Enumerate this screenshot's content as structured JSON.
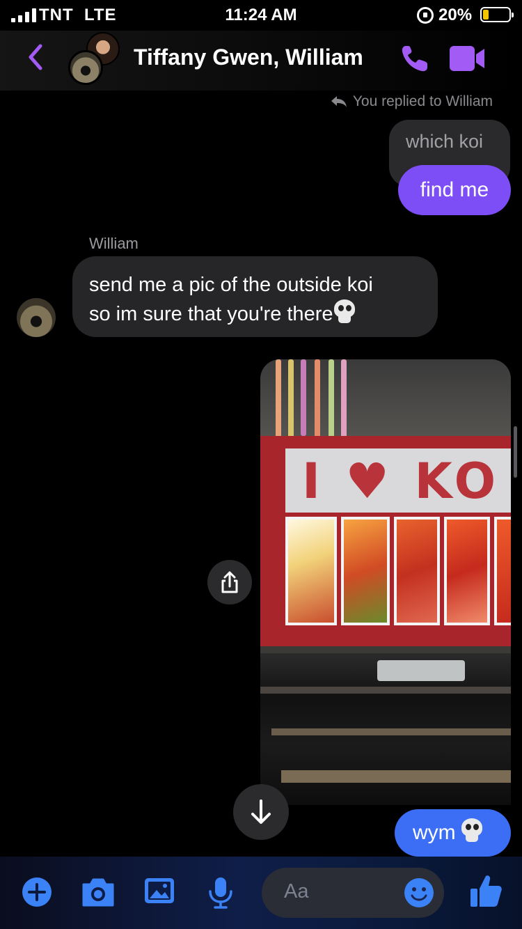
{
  "status_bar": {
    "carrier": "TNT",
    "network": "LTE",
    "time": "11:24 AM",
    "battery": "20%",
    "battery_level": 0.2
  },
  "header": {
    "title": "Tiffany Gwen, William"
  },
  "messages": {
    "reply_context": "You replied to William",
    "quoted_text": "which koi",
    "reply_text": "find me",
    "sender_name": "William",
    "incoming_line1": "send me a pic of the outside koi",
    "incoming_line2": "so im sure that you're there",
    "last_text": "wym"
  },
  "photo": {
    "sign_text": "I ♥ KO"
  },
  "composer": {
    "placeholder": "Aa"
  },
  "colors": {
    "accent_purple": "#7d4df6",
    "accent_blue": "#3b6ef5",
    "icon_purple": "#a35bf5",
    "composer_icon_blue": "#3b82f6"
  }
}
